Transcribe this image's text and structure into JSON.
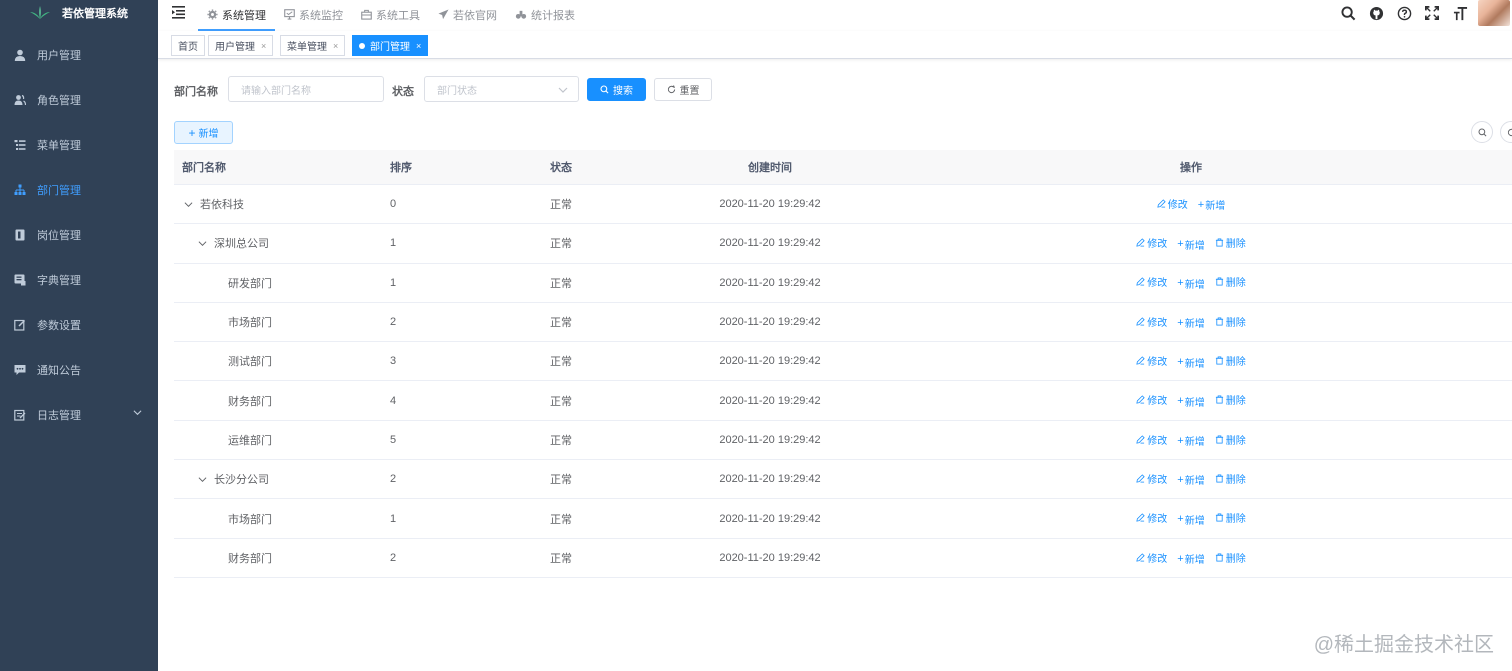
{
  "app": {
    "title": "若依管理系统"
  },
  "sidebar": {
    "items": [
      {
        "label": "用户管理",
        "icon": "user-icon",
        "active": false
      },
      {
        "label": "角色管理",
        "icon": "peoples-icon",
        "active": false
      },
      {
        "label": "菜单管理",
        "icon": "tree-table-icon",
        "active": false
      },
      {
        "label": "部门管理",
        "icon": "tree-icon",
        "active": true
      },
      {
        "label": "岗位管理",
        "icon": "post-icon",
        "active": false
      },
      {
        "label": "字典管理",
        "icon": "dict-icon",
        "active": false
      },
      {
        "label": "参数设置",
        "icon": "edit-icon",
        "active": false
      },
      {
        "label": "通知公告",
        "icon": "message-icon",
        "active": false
      },
      {
        "label": "日志管理",
        "icon": "log-icon",
        "active": false
      }
    ]
  },
  "topnav": {
    "items": [
      {
        "label": "系统管理",
        "icon": "gear-icon"
      },
      {
        "label": "系统监控",
        "icon": "monitor-icon"
      },
      {
        "label": "系统工具",
        "icon": "tool-icon"
      },
      {
        "label": "若依官网",
        "icon": "paper-plane-icon"
      },
      {
        "label": "统计报表",
        "icon": "chart-icon"
      }
    ]
  },
  "tags": {
    "items": [
      {
        "label": "首页"
      },
      {
        "label": "用户管理",
        "close": "×"
      },
      {
        "label": "菜单管理",
        "close": "×"
      },
      {
        "label": "部门管理",
        "close": "×"
      }
    ]
  },
  "search": {
    "dept_label": "部门名称",
    "dept_placeholder": "请输入部门名称",
    "status_label": "状态",
    "status_placeholder": "部门状态",
    "search_button": "搜索",
    "reset_button": "重置"
  },
  "toolbar": {
    "add_button": "新增"
  },
  "table": {
    "headers": {
      "name": "部门名称",
      "sort": "排序",
      "status": "状态",
      "created": "创建时间",
      "actions": "操作"
    },
    "action_labels": {
      "edit": "修改",
      "add": "新增",
      "delete": "删除"
    },
    "rows": [
      {
        "name": "若依科技",
        "level": 0,
        "expandable": true,
        "sort": "0",
        "status": "正常",
        "created": "2020-11-20 19:29:42",
        "deletable": false
      },
      {
        "name": "深圳总公司",
        "level": 1,
        "expandable": true,
        "sort": "1",
        "status": "正常",
        "created": "2020-11-20 19:29:42",
        "deletable": true
      },
      {
        "name": "研发部门",
        "level": 2,
        "expandable": false,
        "sort": "1",
        "status": "正常",
        "created": "2020-11-20 19:29:42",
        "deletable": true
      },
      {
        "name": "市场部门",
        "level": 2,
        "expandable": false,
        "sort": "2",
        "status": "正常",
        "created": "2020-11-20 19:29:42",
        "deletable": true
      },
      {
        "name": "测试部门",
        "level": 2,
        "expandable": false,
        "sort": "3",
        "status": "正常",
        "created": "2020-11-20 19:29:42",
        "deletable": true
      },
      {
        "name": "财务部门",
        "level": 2,
        "expandable": false,
        "sort": "4",
        "status": "正常",
        "created": "2020-11-20 19:29:42",
        "deletable": true
      },
      {
        "name": "运维部门",
        "level": 2,
        "expandable": false,
        "sort": "5",
        "status": "正常",
        "created": "2020-11-20 19:29:42",
        "deletable": true
      },
      {
        "name": "长沙分公司",
        "level": 1,
        "expandable": true,
        "sort": "2",
        "status": "正常",
        "created": "2020-11-20 19:29:42",
        "deletable": true
      },
      {
        "name": "市场部门",
        "level": 2,
        "expandable": false,
        "sort": "1",
        "status": "正常",
        "created": "2020-11-20 19:29:42",
        "deletable": true
      },
      {
        "name": "财务部门",
        "level": 2,
        "expandable": false,
        "sort": "2",
        "status": "正常",
        "created": "2020-11-20 19:29:42",
        "deletable": true
      }
    ]
  },
  "watermark": "@稀土掘金技术社区",
  "colors": {
    "sidebar_bg": "#304156",
    "accent": "#1890ff",
    "menu_text": "#bfcbd9"
  }
}
